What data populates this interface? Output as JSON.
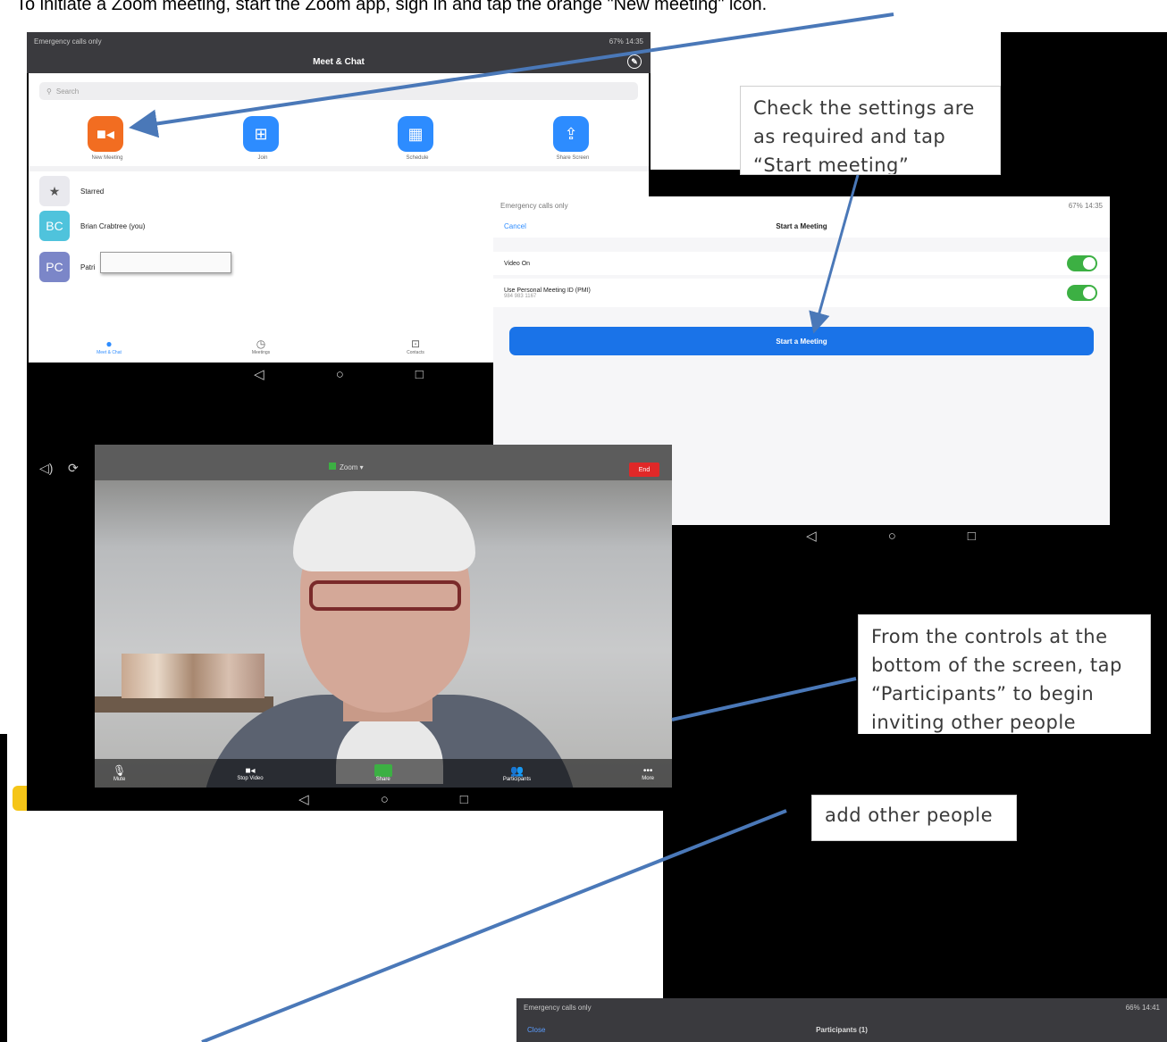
{
  "instruction": "To initiate a Zoom meeting, start the Zoom app, sign in and tap the orange \"New meeting\" icon.",
  "callouts": {
    "settings": "Check the settings are as required and tap “Start meeting”",
    "participants": "From the controls at the bottom of the screen, tap “Participants” to begin inviting other people",
    "add": "add other people"
  },
  "screen1": {
    "status_left": "Emergency calls only",
    "status_right": "67% 14:35",
    "title": "Meet & Chat",
    "search_placeholder": "Search",
    "buttons": [
      "New Meeting",
      "Join",
      "Schedule",
      "Share Screen"
    ],
    "contacts": [
      {
        "initials": "",
        "name": "Starred"
      },
      {
        "initials": "BC",
        "name": "Brian Crabtree (you)"
      },
      {
        "initials": "PC",
        "name": "Patri"
      }
    ],
    "tabs": [
      "Meet & Chat",
      "Meetings",
      "Contacts"
    ]
  },
  "screen2": {
    "status_left": "Emergency calls only",
    "status_right": "67% 14:35",
    "cancel": "Cancel",
    "title": "Start a Meeting",
    "video_label": "Video On",
    "pmi_label": "Use Personal Meeting ID (PMI)",
    "pmi_number": "984 983 1167",
    "start_button": "Start a Meeting"
  },
  "screen3": {
    "zoom_label": "Zoom",
    "end_button": "End",
    "controls": [
      "Mute",
      "Stop Video",
      "Share",
      "Participants",
      "More"
    ]
  },
  "screen4": {
    "status_left": "Emergency calls only",
    "status_right": "66% 14:41",
    "close": "Close",
    "title": "Participants (1)"
  },
  "colors": {
    "zoom_blue": "#2d8cff",
    "new_meeting_orange": "#f26d21",
    "arrow": "#4a78b8",
    "end_red": "#e02828",
    "toggle_green": "#3cb043"
  }
}
